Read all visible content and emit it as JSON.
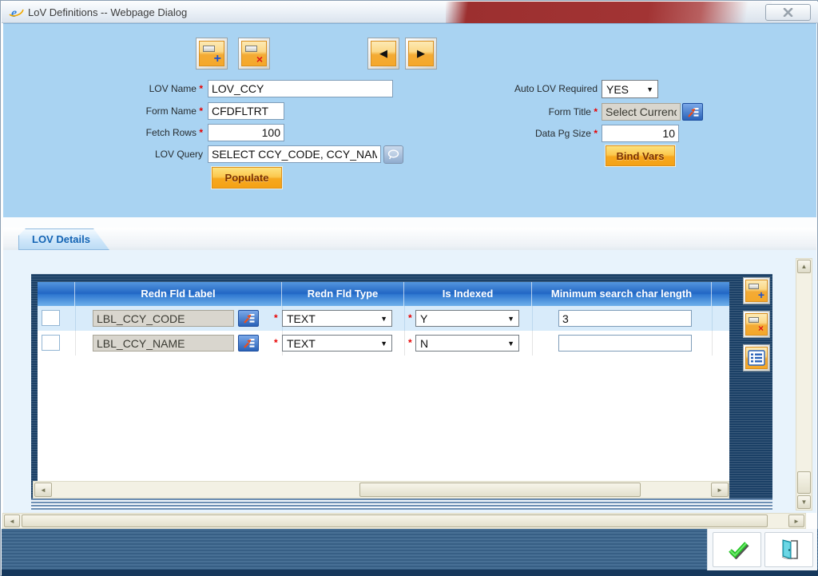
{
  "window": {
    "title": "LoV Definitions -- Webpage Dialog"
  },
  "glyphs": {
    "prev": "◀",
    "next": "▶",
    "dropdown": "▼",
    "plus": "+",
    "cross": "×",
    "up": "▲",
    "down": "▼",
    "left": "◄",
    "right": "►",
    "required": "*"
  },
  "form": {
    "fields": {
      "lov_name": {
        "label": "LOV Name",
        "value": "LOV_CCY"
      },
      "form_name": {
        "label": "Form Name",
        "value": "CFDFLTRT"
      },
      "fetch_rows": {
        "label": "Fetch Rows",
        "value": "100"
      },
      "lov_query": {
        "label": "LOV Query",
        "value": "SELECT CCY_CODE, CCY_NAM"
      },
      "auto_lov_required": {
        "label": "Auto LOV Required",
        "value": "YES"
      },
      "form_title": {
        "label": "Form Title",
        "value": "Select Currenc"
      },
      "data_pg_size": {
        "label": "Data Pg Size",
        "value": "10"
      }
    },
    "buttons": {
      "populate": "Populate",
      "bind_vars": "Bind Vars"
    }
  },
  "tab": {
    "label": "LOV Details"
  },
  "grid": {
    "columns": [
      "",
      "Redn Fld Label",
      "Redn Fld Type",
      "Is Indexed",
      "Minimum search char length"
    ],
    "rows": [
      {
        "label": "LBL_CCY_CODE",
        "type": "TEXT",
        "indexed": "Y",
        "minlen": "3"
      },
      {
        "label": "LBL_CCY_NAME",
        "type": "TEXT",
        "indexed": "N",
        "minlen": ""
      }
    ]
  },
  "colors": {
    "accent_orange": "#f5a82a",
    "header_blue": "#2166c4",
    "panel_blue": "#a9d3f2",
    "navy": "#1b4066",
    "title_red": "#9c2f2f"
  }
}
